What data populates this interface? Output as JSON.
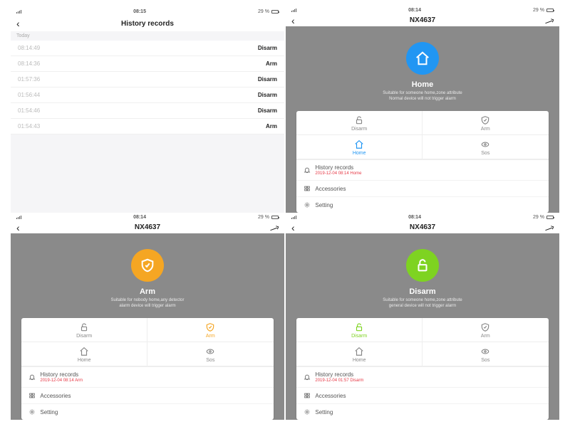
{
  "status_time": "08:14",
  "status_time_hist": "08:15",
  "battery_text": "29 %",
  "screens": {
    "history": {
      "title": "History records",
      "section": "Today",
      "rows": [
        {
          "t": "08:14:49",
          "l": "Disarm"
        },
        {
          "t": "08:14:36",
          "l": "Arm"
        },
        {
          "t": "01:57:36",
          "l": "Disarm"
        },
        {
          "t": "01:56:44",
          "l": "Disarm"
        },
        {
          "t": "01:54:46",
          "l": "Disarm"
        },
        {
          "t": "01:54:43",
          "l": "Arm"
        }
      ]
    },
    "home": {
      "title": "NX4637",
      "hero": "Home",
      "sub1": "Suitable for someone home,zone attribute",
      "sub2": "Normal device will not trigger alarm",
      "history_sub": "2019-12-04 08:14 Home"
    },
    "arm": {
      "title": "NX4637",
      "hero": "Arm",
      "sub1": "Suitable for nobody home,any detector",
      "sub2": "alarm device will trigger alarm",
      "history_sub": "2019-12-04 08:14 Arm"
    },
    "disarm": {
      "title": "NX4637",
      "hero": "Disarm",
      "sub1": "Suitable for someone home,zone attribute",
      "sub2": "general device will not trigger alarm",
      "history_sub": "2019-12-04 01:57 Disarm"
    }
  },
  "modes": {
    "disarm": "Disarm",
    "arm": "Arm",
    "home": "Home",
    "sos": "Sos"
  },
  "menu": {
    "history": "History records",
    "accessories": "Accessories",
    "setting": "Setting"
  },
  "accent": {
    "home": "#2196f3",
    "arm": "#f5a623",
    "disarm": "#7ed321"
  }
}
